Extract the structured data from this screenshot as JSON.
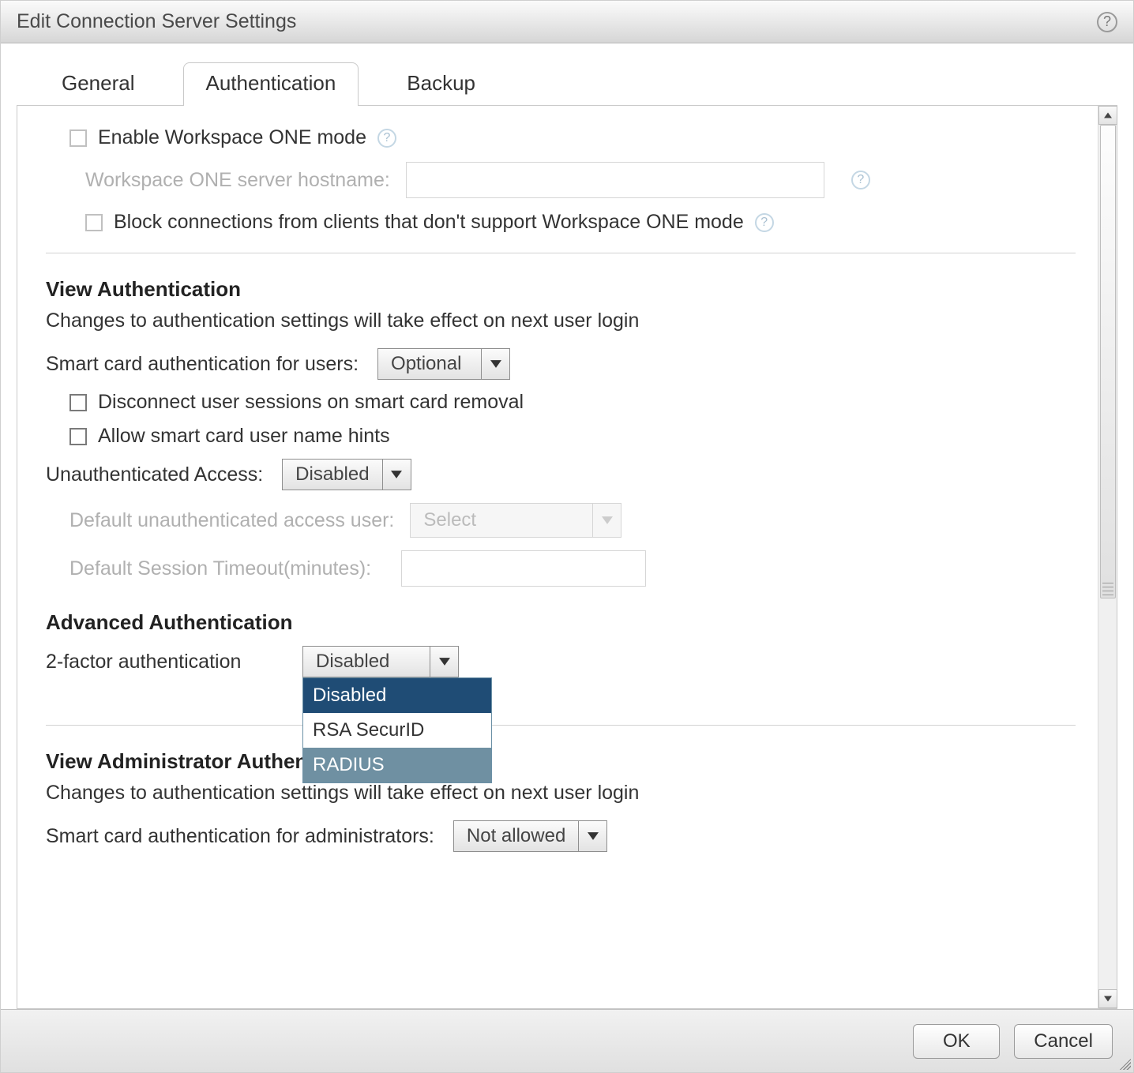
{
  "window": {
    "title": "Edit Connection Server Settings"
  },
  "tabs": {
    "general": "General",
    "authentication": "Authentication",
    "backup": "Backup",
    "active": "authentication"
  },
  "workspace_one": {
    "enable_label": "Enable Workspace ONE mode",
    "hostname_label": "Workspace ONE server hostname:",
    "hostname_value": "",
    "block_label": "Block connections from clients that don't support Workspace ONE mode"
  },
  "view_auth": {
    "heading": "View Authentication",
    "note": "Changes to authentication settings will take effect on next user login",
    "smartcard_label": "Smart card authentication for users:",
    "smartcard_value": "Optional",
    "disconnect_label": "Disconnect user sessions on smart card removal",
    "hints_label": "Allow smart card user name hints",
    "unauth_label": "Unauthenticated Access:",
    "unauth_value": "Disabled",
    "default_user_label": "Default unauthenticated access user:",
    "default_user_value": "Select",
    "timeout_label": "Default Session Timeout(minutes):",
    "timeout_value": ""
  },
  "advanced_auth": {
    "heading": "Advanced Authentication",
    "twofactor_label": "2-factor authentication",
    "twofactor_value": "Disabled",
    "twofactor_options": [
      "Disabled",
      "RSA SecurID",
      "RADIUS"
    ],
    "twofactor_selected_index": 0,
    "twofactor_hover_index": 2
  },
  "admin_auth": {
    "heading": "View Administrator Authentication",
    "note": "Changes to authentication settings will take effect on next user login",
    "smartcard_label": "Smart card authentication for administrators:",
    "smartcard_value": "Not allowed"
  },
  "buttons": {
    "ok": "OK",
    "cancel": "Cancel"
  }
}
